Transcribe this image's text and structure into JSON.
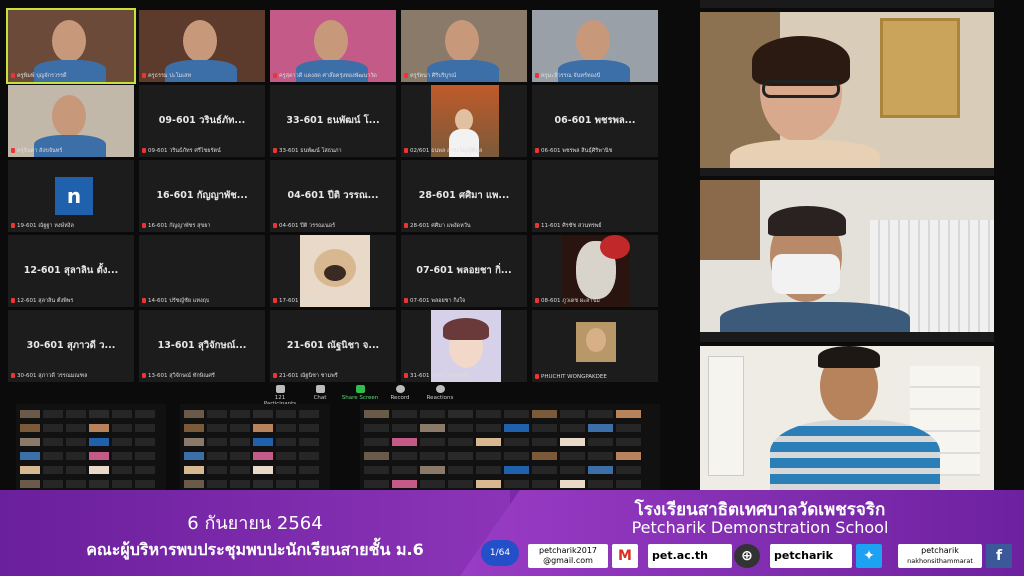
{
  "gallery": {
    "tiles": [
      {
        "name": "",
        "label": "ครูพิมพ์ บุญจักรวรรดิ์",
        "kind": "video",
        "bg": "#6b4a3a"
      },
      {
        "name": "",
        "label": "ครูธรรม ปะโมเสท",
        "kind": "video",
        "bg": "#5c3a2c"
      },
      {
        "name": "",
        "label": "ครูสุดาวดี แดงสด ศาล๊อครุ่งทองพัฒนาวัด",
        "kind": "video",
        "bg": "#c45a88"
      },
      {
        "name": "",
        "label": "ครูรัตนา ศิริบริบูรณ์",
        "kind": "video",
        "bg": "#8a7a6a"
      },
      {
        "name": "",
        "label": "ครูมะลิวรรณ จันทร์ทองนี",
        "kind": "video",
        "bg": "#9aa0a8"
      },
      {
        "name": "",
        "label": "ครูจินดา สังขจันทร์",
        "kind": "video",
        "bg": "#c2b8aa"
      },
      {
        "name": "09-601 วรินธ์ภัท...",
        "label": "09-601 วรินธ์ภัทร ศรีไชยรัตน์",
        "kind": "name"
      },
      {
        "name": "33-601 ธนพัฒน์ โ...",
        "label": "33-601 ธนพัฒน์ โสธนภา",
        "kind": "name"
      },
      {
        "name": "",
        "label": "02/601 ธนพล สาระวิญญ์ติบุล",
        "kind": "photo",
        "bg": "#7b5a3a"
      },
      {
        "name": "06-601 พชรพล...",
        "label": "06-601 พชรพล สินธุ์ศิริพานิช",
        "kind": "name"
      },
      {
        "name": "",
        "label": "19-601 ณัฐฐา หงษ์หงิล",
        "kind": "letter",
        "letter": "n"
      },
      {
        "name": "16-601 กัญญาพัช...",
        "label": "16-601 กัญญาพัชร สุขยา",
        "kind": "name"
      },
      {
        "name": "04-601 ปีติ วรรณ...",
        "label": "04-601 ปีติ วรรณเนอร์",
        "kind": "name"
      },
      {
        "name": "28-601 ศศิมา แพ...",
        "label": "28-601 ศศิมา แพงัดหวัน",
        "kind": "name"
      },
      {
        "name": "",
        "label": "11-601 ศิรชัช สวนทรพย์",
        "kind": "name"
      },
      {
        "name": "12-601 สุลาลิน ตั้ง...",
        "label": "12-601 สุลาลิน ตั้งพิพร",
        "kind": "name"
      },
      {
        "name": "",
        "label": "14-601 ปรัชญ์ชัย แทงฤบ",
        "kind": "name"
      },
      {
        "name": "",
        "label": "17-601 ภาวิน มาวงินโชค",
        "kind": "pug"
      },
      {
        "name": "07-601 พลอยชา กิ่...",
        "label": "07-601 พลอยชา กิ่งใจ",
        "kind": "name"
      },
      {
        "name": "",
        "label": "08-601 ภูวเดช ผะลาขิม",
        "kind": "mask"
      },
      {
        "name": "30-601 สุภาวดี ว...",
        "label": "30-601 สุภาวดี วรรณมณฑล",
        "kind": "name"
      },
      {
        "name": "13-601 สุวิจักษณ์...",
        "label": "13-601 สุวิจักษณ์ ทักษิณศรี",
        "kind": "name"
      },
      {
        "name": "21-601 ณัฐนิชา จ...",
        "label": "21-601 ณัฐนิชา ชามพรี",
        "kind": "name"
      },
      {
        "name": "",
        "label": "31-601 ศุภชา โคทรัศน์",
        "kind": "anime"
      },
      {
        "name": "",
        "label": "PHUCHIT WONGPAKDEE",
        "kind": "selfie"
      }
    ]
  },
  "toolbar": {
    "participants_count": "121",
    "participants_label": "Participants",
    "chat_label": "Chat",
    "share_label": "Share Screen",
    "record_label": "Record",
    "reactions_label": "Reactions"
  },
  "banner": {
    "date": "6 กันยายน 2564",
    "caption": "คณะผู้บริหารพบประชุมพบปะนักเรียนสายชั้น ม.6",
    "school_th": "โรงเรียนสาธิตเทศบาลวัดเพชรจริก",
    "school_en": "Petcharik Demonstration School",
    "page": "1/64",
    "email": "petcharik2017\n@gmail.com",
    "website": "pet.ac.th",
    "twitter": "petcharik",
    "facebook_line1": "petcharik",
    "facebook_line2": "nakhonsithammarat"
  },
  "colors": {
    "banner_purple": "#7a2aa8",
    "active_speaker": "#c9e23a",
    "share_green": "#2fbd4c"
  }
}
